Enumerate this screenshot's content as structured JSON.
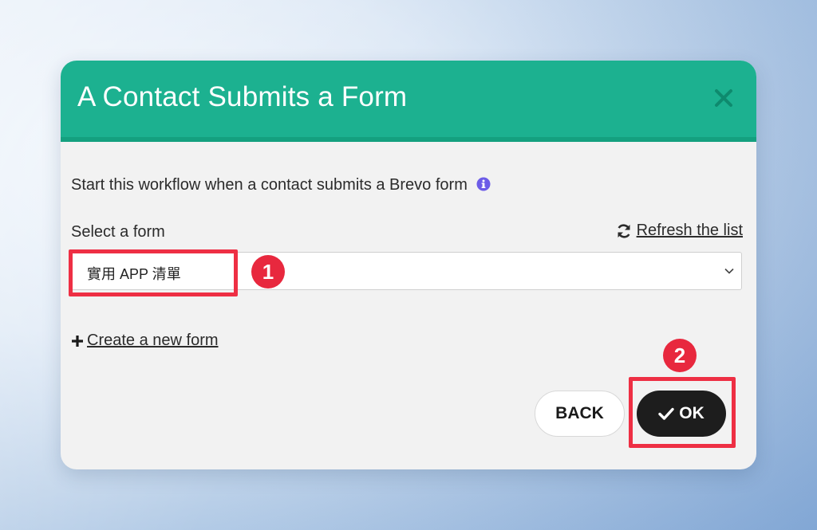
{
  "dialog": {
    "title": "A Contact Submits a Form",
    "close_icon": "close-icon",
    "description": "Start this workflow when a contact submits a Brevo form",
    "info_icon": "info-icon",
    "select_label": "Select a form",
    "refresh_label": "Refresh the list",
    "refresh_icon": "refresh-icon",
    "selected_form": "實用 APP 清單",
    "create_form_label": "Create a new form",
    "create_icon": "plus-icon",
    "back_label": "BACK",
    "ok_label": "OK",
    "ok_icon": "check-icon"
  },
  "annotations": {
    "step1": "1",
    "step2": "2"
  },
  "colors": {
    "header": "#1cb190",
    "annotation": "#ee2f44",
    "ok_button": "#1d1d1d",
    "info_icon": "#6c5ce7"
  }
}
